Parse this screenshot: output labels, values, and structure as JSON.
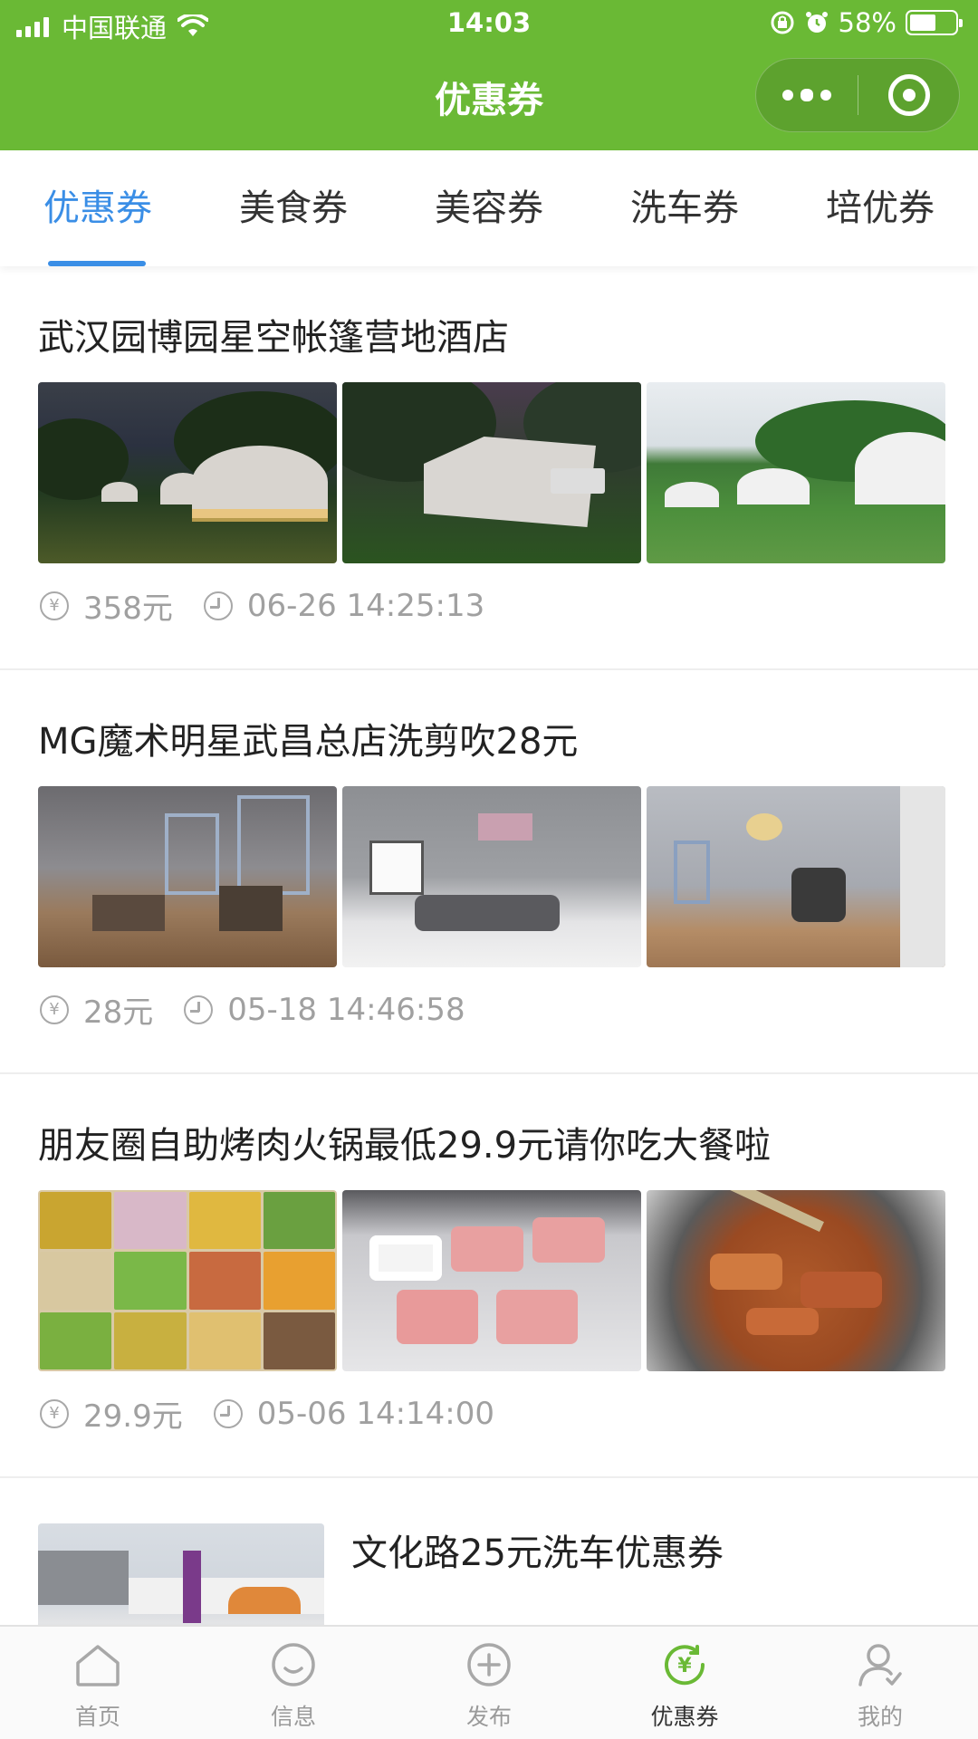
{
  "status_bar": {
    "carrier": "中国联通",
    "time": "14:03",
    "battery": "58%",
    "battery_level": 0.58
  },
  "nav": {
    "title": "优惠券",
    "more_icon": "more-dots-icon",
    "close_icon": "target-icon"
  },
  "tabs": [
    {
      "label": "优惠券",
      "active": true
    },
    {
      "label": "美食券",
      "active": false
    },
    {
      "label": "美容券",
      "active": false
    },
    {
      "label": "洗车券",
      "active": false
    },
    {
      "label": "培优券",
      "active": false
    }
  ],
  "posts": [
    {
      "title": "武汉园博园星空帐篷营地酒店",
      "price": "358元",
      "time": "06-26 14:25:13"
    },
    {
      "title": "MG魔术明星武昌总店洗剪吹28元",
      "price": "28元",
      "time": "05-18 14:46:58"
    },
    {
      "title": "朋友圈自助烤肉火锅最低29.9元请你吃大餐啦",
      "price": "29.9元",
      "time": "05-06 14:14:00"
    },
    {
      "title": "文化路25元洗车优惠券"
    }
  ],
  "bottom_nav": [
    {
      "label": "首页",
      "icon": "home-icon",
      "active": false
    },
    {
      "label": "信息",
      "icon": "message-icon",
      "active": false
    },
    {
      "label": "发布",
      "icon": "publish-plus-icon",
      "active": false
    },
    {
      "label": "优惠券",
      "icon": "coupon-yen-icon",
      "active": true
    },
    {
      "label": "我的",
      "icon": "profile-icon",
      "active": false
    }
  ],
  "colors": {
    "brand_green": "#6ab935",
    "active_tab_blue": "#3a8ee6",
    "meta_gray": "#a0a0a0"
  }
}
